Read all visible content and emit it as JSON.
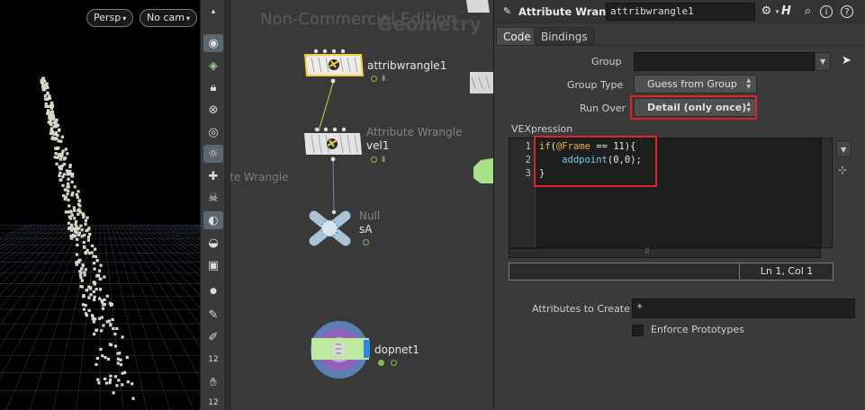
{
  "viewport": {
    "camera_menu": "Persp",
    "cam_select": "No cam"
  },
  "toolbar": {
    "icons": [
      "display-options-icon",
      "ghost-icon",
      "lock-icon",
      "snap-icon",
      "camera-icon",
      "light-icon",
      "add-light-icon",
      "skull-icon",
      "shade-icon",
      "visibility-icon",
      "render-icon",
      "point-icon",
      "brush-icon",
      "pen-icon",
      "frame-count-icon",
      "sculpt-icon",
      "frame-count-icon-2"
    ],
    "labels": {
      "frame_a": "12",
      "frame_b": "12"
    }
  },
  "network": {
    "watermark_commercial": "Non-Commercial Edition",
    "watermark_context": "Geometry",
    "offscreen_label": "te Wrangle",
    "nodes": [
      {
        "name": "attribwrangle1",
        "type": ""
      },
      {
        "name": "vel1",
        "type": "Attribute Wrangle"
      },
      {
        "name": "sA",
        "type": "Null"
      },
      {
        "name": "dopnet1",
        "type": ""
      }
    ]
  },
  "params": {
    "node_type": "Attribute Wrangle",
    "node_name": "attribwrangle1",
    "tabs": [
      {
        "label": "Code",
        "active": true
      },
      {
        "label": "Bindings",
        "active": false
      }
    ],
    "group": {
      "label": "Group",
      "value": ""
    },
    "group_type": {
      "label": "Group Type",
      "value": "Guess from Group"
    },
    "run_over": {
      "label": "Run Over",
      "value": "Detail (only once)"
    },
    "vex_label": "VEXpression",
    "code": {
      "line_numbers": [
        "1",
        "2",
        "3"
      ],
      "lines": [
        "if(@Frame == 11){",
        "    addpoint(0,0);",
        "}"
      ]
    },
    "status": "Ln 1, Col 1",
    "attributes_to_create": {
      "label": "Attributes to Create",
      "value": "*"
    },
    "enforce_prototypes": {
      "label": "Enforce Prototypes",
      "checked": false
    }
  },
  "colors": {
    "highlight": "#e0202a",
    "keyword": "#e6c04c",
    "function": "#6ecfe8",
    "flag_green": "#7fc14a",
    "wrangle_selected": "#f2d03a"
  }
}
